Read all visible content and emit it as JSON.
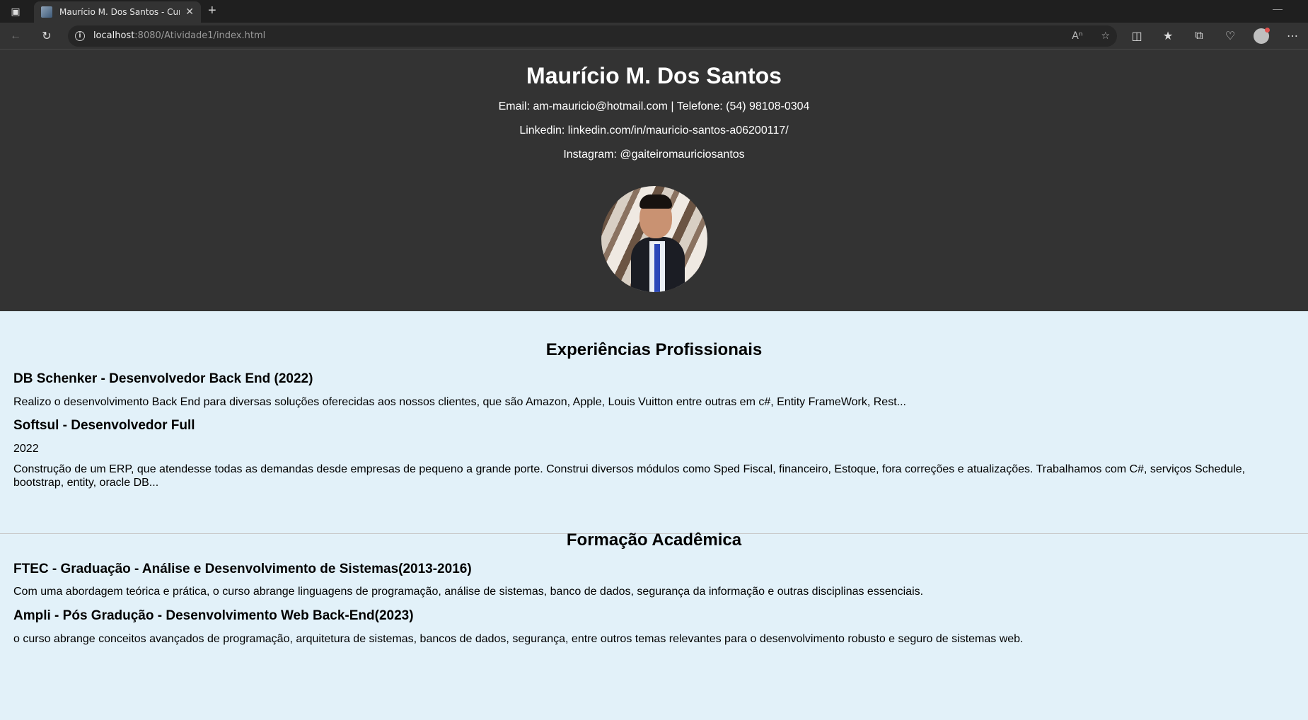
{
  "browser": {
    "tab_title": "Maurício M. Dos Santos - Currículo",
    "url_host": "localhost",
    "url_rest": ":8080/Atividade1/index.html"
  },
  "header": {
    "name": "Maurício M. Dos Santos",
    "contact_line1": "Email: am-mauricio@hotmail.com | Telefone: (54) 98108-0304",
    "contact_line2": "Linkedin: linkedin.com/in/mauricio-santos-a06200117/",
    "contact_line3": "Instagram: @gaiteiromauriciosantos"
  },
  "experience": {
    "title": "Experiências Profissionais",
    "items": [
      {
        "heading": "DB Schenker - Desenvolvedor Back End (2022)",
        "year": "",
        "description": "Realizo o desenvolvimento Back End para diversas soluções oferecidas aos nossos clientes, que são Amazon, Apple, Louis Vuitton entre outras em c#, Entity FrameWork, Rest..."
      },
      {
        "heading": "Softsul - Desenvolvedor Full",
        "year": "2022",
        "description": "Construção de um ERP, que atendesse todas as demandas desde empresas de pequeno a grande porte. Construi diversos módulos como Sped Fiscal, financeiro, Estoque, fora correções e atualizações. Trabalhamos com C#, serviços Schedule, bootstrap, entity, oracle DB..."
      }
    ]
  },
  "education": {
    "title": "Formação Acadêmica",
    "items": [
      {
        "heading": "FTEC - Graduação - Análise e Desenvolvimento de Sistemas(2013-2016)",
        "description": "Com uma abordagem teórica e prática, o curso abrange linguagens de programação, análise de sistemas, banco de dados, segurança da informação e outras disciplinas essenciais."
      },
      {
        "heading": "Ampli - Pós Gradução - Desenvolvimento Web Back-End(2023)",
        "description": "o curso abrange conceitos avançados de programação, arquitetura de sistemas, bancos de dados, segurança, entre outros temas relevantes para o desenvolvimento robusto e seguro de sistemas web."
      }
    ]
  },
  "colors": {
    "header_bg": "#333333",
    "body_bg": "#e2f1f9"
  }
}
